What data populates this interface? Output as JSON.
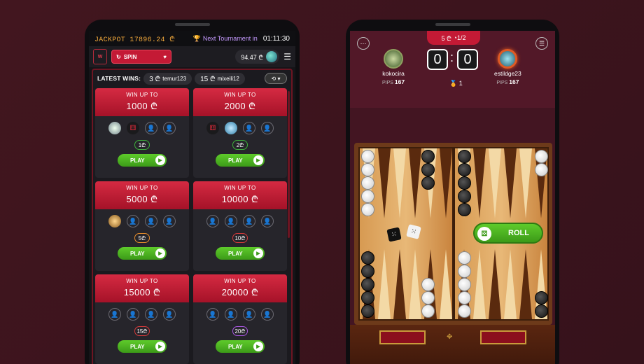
{
  "left": {
    "jackpot": "JACKPOT 17896.24 ₾",
    "next_tournament": "Next Tournament in",
    "timer": "01:11:30",
    "spin": "SPIN",
    "balance": "94.47 ₾",
    "latest_wins_label": "LATEST WINS:",
    "wins": [
      {
        "amount": "3 ₾",
        "user": "temur123"
      },
      {
        "amount": "15 ₾",
        "user": "mixeili12"
      }
    ],
    "cards": [
      {
        "label": "WIN UP TO",
        "amount": "1000 ₾",
        "fee": "1₾",
        "play": "PLAY"
      },
      {
        "label": "WIN UP TO",
        "amount": "2000 ₾",
        "fee": "2₾",
        "play": "PLAY"
      },
      {
        "label": "WIN UP TO",
        "amount": "5000 ₾",
        "fee": "5₾",
        "play": "PLAY"
      },
      {
        "label": "WIN UP TO",
        "amount": "10000 ₾",
        "fee": "10₾",
        "play": "PLAY"
      },
      {
        "label": "WIN UP TO",
        "amount": "15000 ₾",
        "fee": "15₾",
        "play": "PLAY"
      },
      {
        "label": "WIN UP TO",
        "amount": "20000 ₾",
        "fee": "20₾",
        "play": "PLAY"
      }
    ]
  },
  "right": {
    "stake": "5 ₾",
    "round": "1/2",
    "score_left": "0",
    "score_right": "0",
    "medal_count": "1",
    "player1": {
      "name": "kokocira",
      "pips_label": "PIPS",
      "pips": "167"
    },
    "player2": {
      "name": "estildge23",
      "pips_label": "PIPS",
      "pips": "167"
    },
    "roll": "ROLL"
  },
  "colors": {
    "accent": "#c41a35",
    "green": "#4caf23",
    "bg": "#3c1520"
  }
}
